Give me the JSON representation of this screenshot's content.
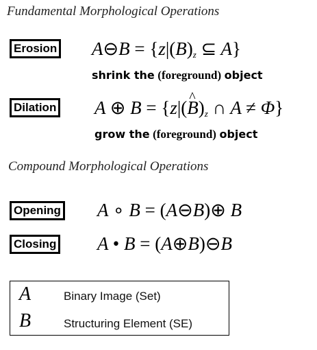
{
  "headings": {
    "fundamental": "Fundamental Morphological Operations",
    "compound": "Compound Morphological Operations"
  },
  "operations": [
    {
      "label": "Erosion",
      "formula": {
        "a": "A",
        "op": "⊖",
        "b": "B",
        "eq": "=",
        "lb": "{",
        "z1": "z",
        "bar": "|",
        "lp": "(",
        "b2": "B",
        "rp": ")",
        "sub": "z",
        "rel": "⊆",
        "a2": "A",
        "rb": "}"
      },
      "description": {
        "verb": "shrink the",
        "paren": "(foreground)",
        "noun": "object"
      }
    },
    {
      "label": "Dilation",
      "formula": {
        "a": "A",
        "op": "⊕",
        "b": "B",
        "eq": "=",
        "lb": "{",
        "z1": "z",
        "bar": "|",
        "lp": "(",
        "b2": "B",
        "rp": ")",
        "sub": "z",
        "rel": "∩",
        "a2": "A",
        "neq": "≠",
        "phi": "Φ",
        "rb": "}"
      },
      "description": {
        "verb": "grow the",
        "paren": "(foreground)",
        "noun": "object"
      }
    },
    {
      "label": "Opening",
      "formula": {
        "a": "A",
        "op": "∘",
        "b": "B",
        "eq": "=",
        "lp": "(",
        "a2": "A",
        "op2": "⊖",
        "b2": "B",
        "rp": ")",
        "op3": "⊕",
        "b3": "B"
      }
    },
    {
      "label": "Closing",
      "formula": {
        "a": "A",
        "op": "•",
        "b": "B",
        "eq": "=",
        "lp": "(",
        "a2": "A",
        "op2": "⊕",
        "b2": "B",
        "rp": ")",
        "op3": "⊖",
        "b3": "B"
      }
    }
  ],
  "legend": [
    {
      "symbol": "A",
      "text": "Binary Image (Set)"
    },
    {
      "symbol": "B",
      "text": "Structuring Element (SE)"
    }
  ]
}
